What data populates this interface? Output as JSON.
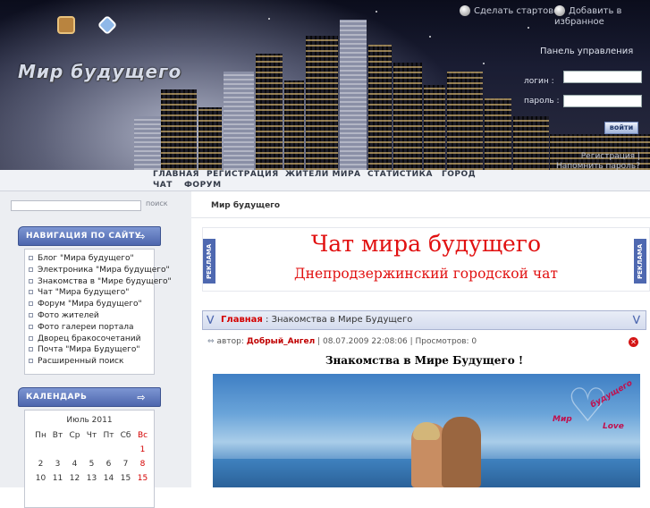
{
  "header": {
    "logo_text": "Мир будущего",
    "make_home_link": "Сделать стартовой",
    "add_favorites_link": "Добавить в избранное",
    "panel_title": "Панель управления",
    "login_label": "логин :",
    "password_label": "пароль :",
    "login_button": "войти",
    "forgot_link": "Регистрация | Напомнить пароль?"
  },
  "topnav": {
    "home": "ГЛАВНАЯ",
    "register": "РЕГИСТРАЦИЯ",
    "residents": "ЖИТЕЛИ МИРА",
    "stats": "СТАТИСТИКА",
    "city": "ГОРОД",
    "chat": "ЧАТ",
    "forum": "ФОРУМ"
  },
  "search": {
    "button": "поиск"
  },
  "nav_block": {
    "title": "НАВИГАЦИЯ ПО САЙТУ",
    "items": [
      "Блог \"Мира будущего\"",
      "Электроника \"Мира будущего\"",
      "Знакомства в \"Мире будущего\"",
      "Чат \"Мира будущего\"",
      "Форум \"Мира будущего\"",
      "Фото жителей",
      "Фото галереи портала",
      "Дворец бракосочетаний",
      "Почта \"Мира Будущего\"",
      "Расширенный поиск"
    ]
  },
  "calendar": {
    "title": "КАЛЕНДАРЬ",
    "month": "Июль 2011",
    "weekdays": [
      "Пн",
      "Вт",
      "Ср",
      "Чт",
      "Пт",
      "Сб",
      "Вс"
    ],
    "weeks": [
      [
        "",
        "",
        "",
        "",
        "",
        "",
        "1"
      ],
      [
        "2",
        "3",
        "4",
        "5",
        "6",
        "7",
        "8"
      ],
      [
        "10",
        "11",
        "12",
        "13",
        "14",
        "15",
        "15"
      ]
    ]
  },
  "breadcrumb": "Мир будущего",
  "ad": {
    "tag": "РЕКЛАМА",
    "title": "Чат мира будущего",
    "subtitle": "Днепродзержинский городской чат"
  },
  "post": {
    "breadcrumb_home": "Главная",
    "breadcrumb_sep": " : ",
    "breadcrumb_title": "Знакомства в Мире Будущего",
    "meta_author_label": "автор:",
    "author": "Добрый_Ангел",
    "meta_rest": "| 08.07.2009 22:08:06 | Просмотров: 0",
    "title": "Знакомства в Мире Будущего !",
    "image_logo_word1": "Мир",
    "image_logo_word2": "будущего",
    "image_logo_word3": "Love"
  },
  "colors": {
    "accent_blue": "#4e68b0",
    "ad_red": "#e11010",
    "sunday_red": "#d40000"
  }
}
